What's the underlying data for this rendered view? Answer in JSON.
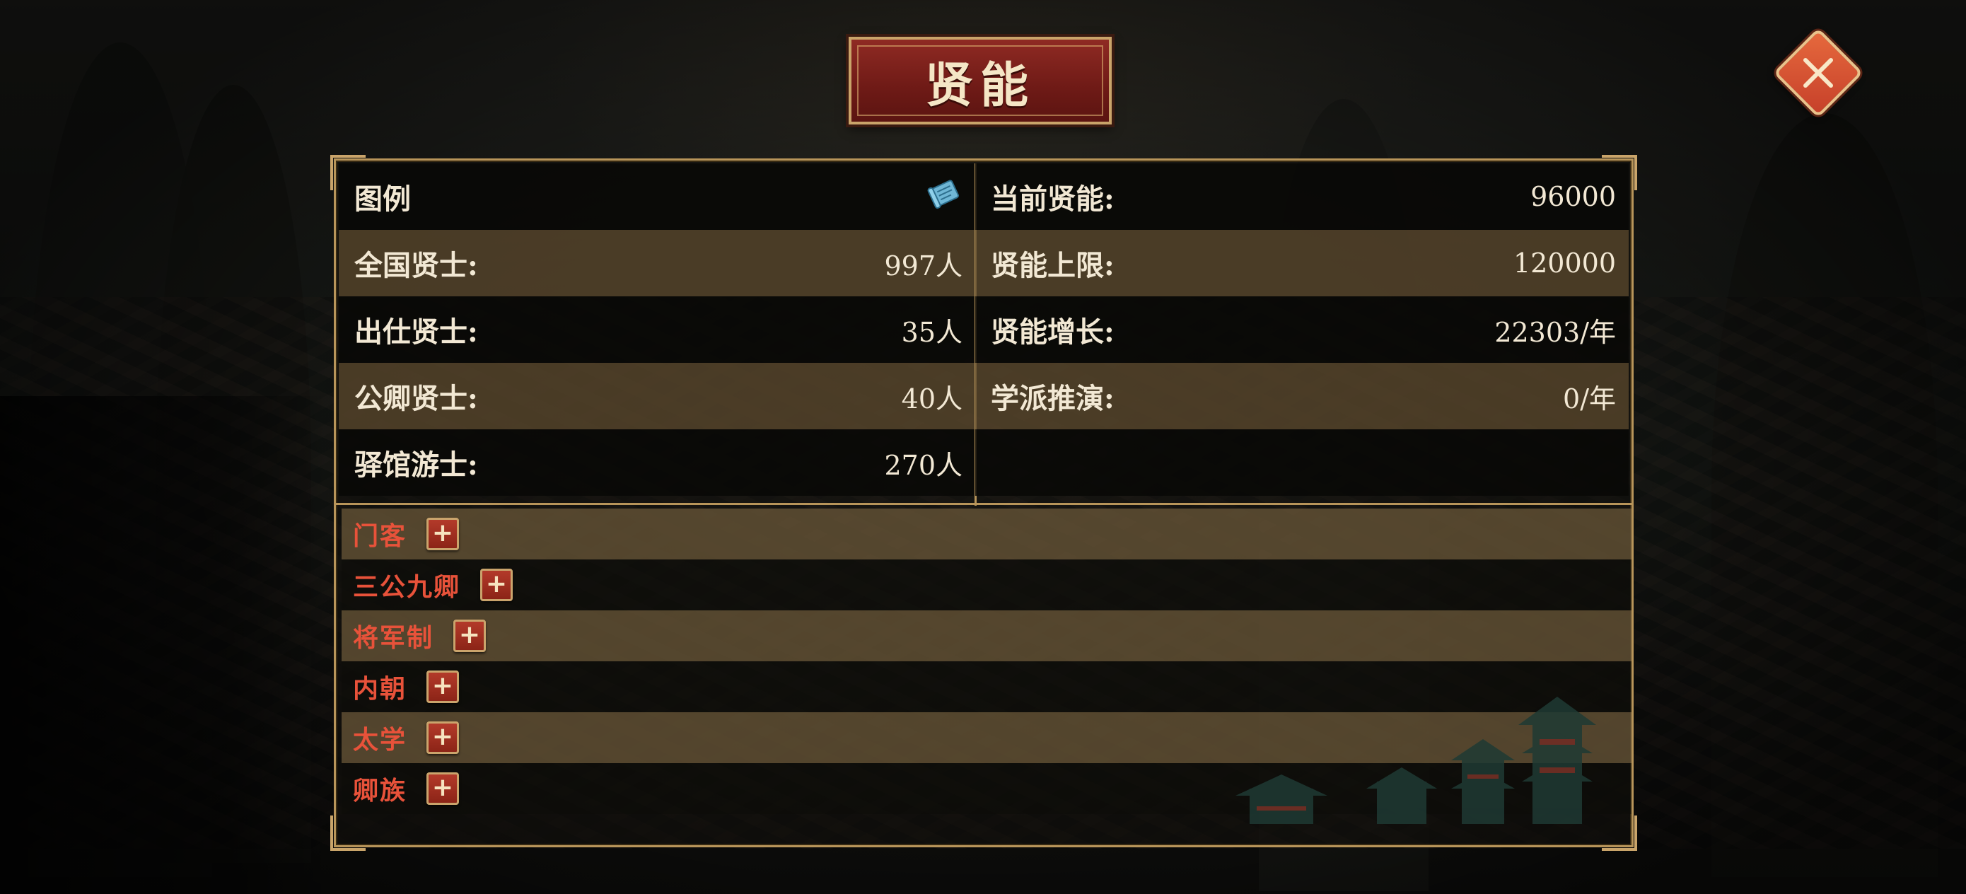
{
  "title": "贤能",
  "icons": {
    "close": "close-icon",
    "legend": "scroll-icon",
    "expand": "plus-icon"
  },
  "colors": {
    "category_text": "#e8523a",
    "panel_border": "#b8955a",
    "title_plaque": "#7a1f19"
  },
  "legend": {
    "label": "图例"
  },
  "left_stats": [
    {
      "label": "全国贤士:",
      "value": "997人"
    },
    {
      "label": "出仕贤士:",
      "value": "35人"
    },
    {
      "label": "公卿贤士:",
      "value": "40人"
    },
    {
      "label": "驿馆游士:",
      "value": "270人"
    }
  ],
  "right_stats": [
    {
      "label": "当前贤能:",
      "value": "96000"
    },
    {
      "label": "贤能上限:",
      "value": "120000"
    },
    {
      "label": "贤能增长:",
      "value": "22303/年"
    },
    {
      "label": "学派推演:",
      "value": "0/年"
    }
  ],
  "categories": [
    {
      "label": "门客",
      "expand": "+"
    },
    {
      "label": "三公九卿",
      "expand": "+"
    },
    {
      "label": "将军制",
      "expand": "+"
    },
    {
      "label": "内朝",
      "expand": "+"
    },
    {
      "label": "太学",
      "expand": "+"
    },
    {
      "label": "卿族",
      "expand": "+"
    }
  ]
}
